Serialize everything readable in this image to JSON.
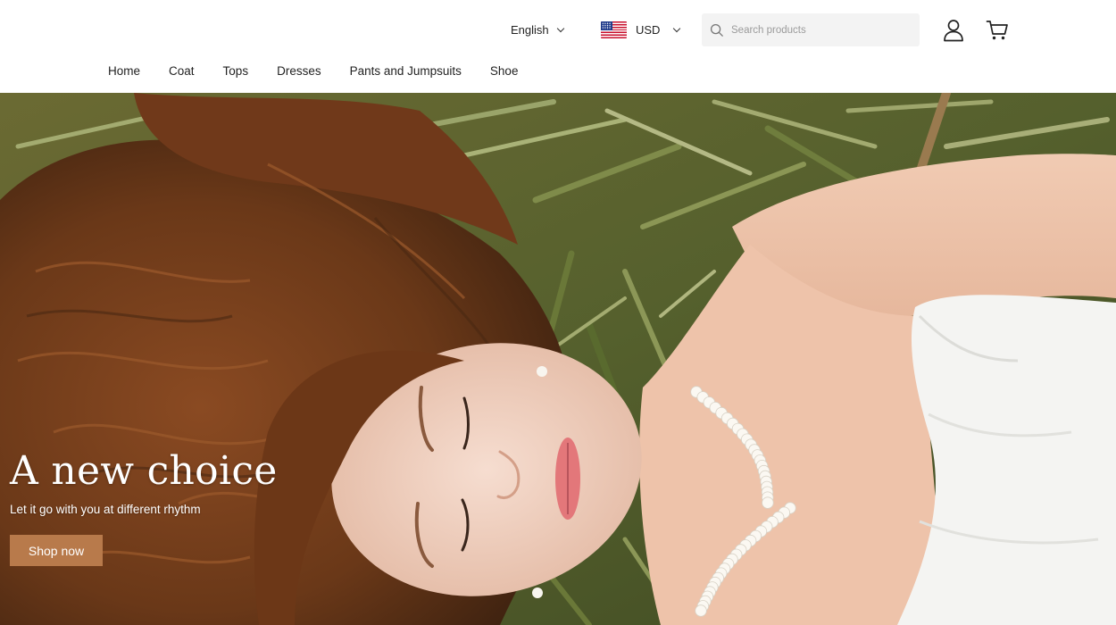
{
  "header": {
    "language": "English",
    "currency": {
      "code": "USD",
      "flag_icon": "us-flag-icon"
    },
    "search": {
      "placeholder": "Search products",
      "value": ""
    },
    "account_icon": "user-icon",
    "cart_icon": "cart-icon"
  },
  "nav": {
    "items": [
      {
        "label": "Home"
      },
      {
        "label": "Coat"
      },
      {
        "label": "Tops"
      },
      {
        "label": "Dresses"
      },
      {
        "label": "Pants and Jumpsuits"
      },
      {
        "label": "Shoe"
      }
    ]
  },
  "hero": {
    "title": "A new choice",
    "subtitle": "Let it go with you at different rhythm",
    "button_label": "Shop now",
    "button_color": "#b87a4b"
  }
}
